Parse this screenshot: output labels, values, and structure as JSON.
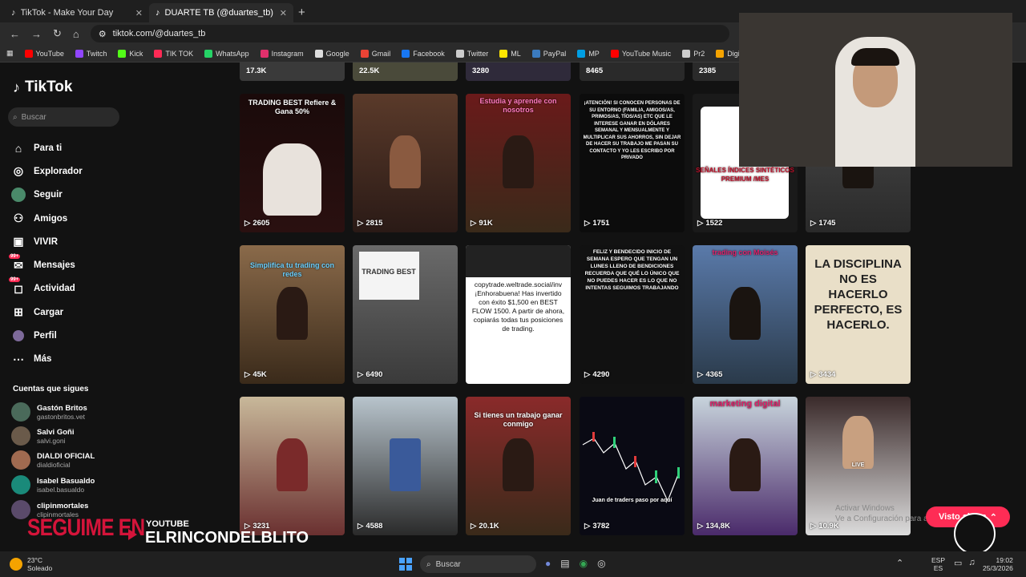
{
  "browser": {
    "tabs": [
      {
        "title": "TikTok - Make Your Day",
        "active": false
      },
      {
        "title": "DUARTE TB (@duartes_tb) | TikT",
        "active": true
      }
    ],
    "url": "tiktok.com/@duartes_tb",
    "bookmarks": [
      {
        "label": "YouTube",
        "color": "#ff0000"
      },
      {
        "label": "Twitch",
        "color": "#9146ff"
      },
      {
        "label": "Kick",
        "color": "#53fc18"
      },
      {
        "label": "TIK TOK",
        "color": "#ff2a55"
      },
      {
        "label": "WhatsApp",
        "color": "#25d366"
      },
      {
        "label": "Instagram",
        "color": "#e1306c"
      },
      {
        "label": "Google",
        "color": "#dddddd"
      },
      {
        "label": "Gmail",
        "color": "#ea4335"
      },
      {
        "label": "Facebook",
        "color": "#1877f2"
      },
      {
        "label": "Twitter",
        "color": "#cccccc"
      },
      {
        "label": "ML",
        "color": "#ffe600"
      },
      {
        "label": "PayPal",
        "color": "#3b7bbf"
      },
      {
        "label": "MP",
        "color": "#009ee3"
      },
      {
        "label": "YouTube Music",
        "color": "#ff0000"
      },
      {
        "label": "Pr2",
        "color": "#cccccc"
      },
      {
        "label": "Digimon Tamers - a...",
        "color": "#f4a300"
      }
    ]
  },
  "sidebar": {
    "logo": "TikTok",
    "search_placeholder": "Buscar",
    "nav": [
      {
        "label": "Para ti",
        "icon": "home-icon"
      },
      {
        "label": "Explorador",
        "icon": "compass-icon"
      },
      {
        "label": "Seguir",
        "icon": "following-avatar-icon"
      },
      {
        "label": "Amigos",
        "icon": "friends-icon"
      },
      {
        "label": "VIVIR",
        "icon": "live-icon"
      },
      {
        "label": "Mensajes",
        "icon": "messages-icon",
        "badge": "99+"
      },
      {
        "label": "Actividad",
        "icon": "activity-icon",
        "badge": "99+"
      },
      {
        "label": "Cargar",
        "icon": "upload-icon"
      },
      {
        "label": "Perfil",
        "icon": "profile-icon"
      },
      {
        "label": "Más",
        "icon": "more-icon"
      }
    ],
    "following_title": "Cuentas que sigues",
    "following": [
      {
        "name": "Gastón Britos",
        "handle": "gastonbritos.vet"
      },
      {
        "name": "Salvi Goñi",
        "handle": "salvi.goni"
      },
      {
        "name": "DIALDI OFICIAL",
        "handle": "dialdioficial"
      },
      {
        "name": "Isabel Basualdo",
        "handle": "isabel.basualdo"
      },
      {
        "name": "clipinmortales",
        "handle": "clipinmortales"
      }
    ]
  },
  "videos_top": [
    "17.3K",
    "22.5K",
    "3280",
    "8465",
    "2385"
  ],
  "videos": [
    {
      "views": "2605",
      "text": "TRADING BEST Refiere & Gana 50%"
    },
    {
      "views": "2815",
      "text": ""
    },
    {
      "views": "91K",
      "text": "Estudia y aprende con nosotros"
    },
    {
      "views": "1751",
      "text": "¡ATENCIÓN! SI CONOCEN PERSONAS DE SU ENTORNO (FAMILIA, AMIGOS/AS, PRIMOS/AS, TÍOS/AS) ETC QUE LE INTERESE GANAR EN DÓLARES SEMANAL Y MENSUALMENTE Y MULTIPLICAR SUS AHORROS, SIN DEJAR DE HACER SU TRABAJO ME PASAN SU CONTACTO Y YO LES ESCRIBO POR PRIVADO"
    },
    {
      "views": "1522",
      "text": "SEÑALES ÍNDICES SINTÉTICOS PREMIUM /MES"
    },
    {
      "views": "1745",
      "text": ""
    },
    {
      "views": "45K",
      "text": "Simplifica tu trading con redes"
    },
    {
      "views": "6490",
      "text": "TRADING BEST"
    },
    {
      "views": "",
      "text": "copytrade.weltrade.social/inv ¡Enhorabuena! Has invertido con éxito $1,500 en BEST FLOW 1500. A partir de ahora, copiarás todas tus posiciones de trading."
    },
    {
      "views": "4290",
      "text": "FELIZ Y BENDECIDO INICIO DE SEMANA ESPERO QUE TENGAN UN LUNES LLENO DE BENDICIONES RECUERDA QUE QUÉ LO ÚNICO QUE NO PUEDES HACER ES LO QUE NO INTENTAS SEGUIMOS TRABAJANDO"
    },
    {
      "views": "4365",
      "text": "trading con Moisés"
    },
    {
      "views": "3434",
      "text": "LA DISCIPLINA NO ES HACERLO PERFECTO, ES HACERLO."
    },
    {
      "views": "3231",
      "text": ""
    },
    {
      "views": "4588",
      "text": ""
    },
    {
      "views": "20.1K",
      "text": "Si tienes un trabajo ganar conmigo"
    },
    {
      "views": "3782",
      "text": "Juan de traders paso por aquí"
    },
    {
      "views": "134,8K",
      "text": "marketing digital"
    },
    {
      "views": "10.9K",
      "text": "LIVE"
    }
  ],
  "webcam": {
    "label": "streamer-webcam"
  },
  "overlay": {
    "left": "SEGUIME EN",
    "platform": "YOUTUBE",
    "channel": "ELRINCONDELBLITO"
  },
  "watermark": {
    "line1": "Activar Windows",
    "line2": "Ve a Configuración para activar Windows."
  },
  "visto_button": "Visto ahora",
  "taskbar": {
    "weather_temp": "23°C",
    "weather_desc": "Soleado",
    "search_placeholder": "Buscar",
    "lang1": "ESP",
    "lang2": "ES",
    "time": "19:02",
    "date": "25/3/2026"
  }
}
